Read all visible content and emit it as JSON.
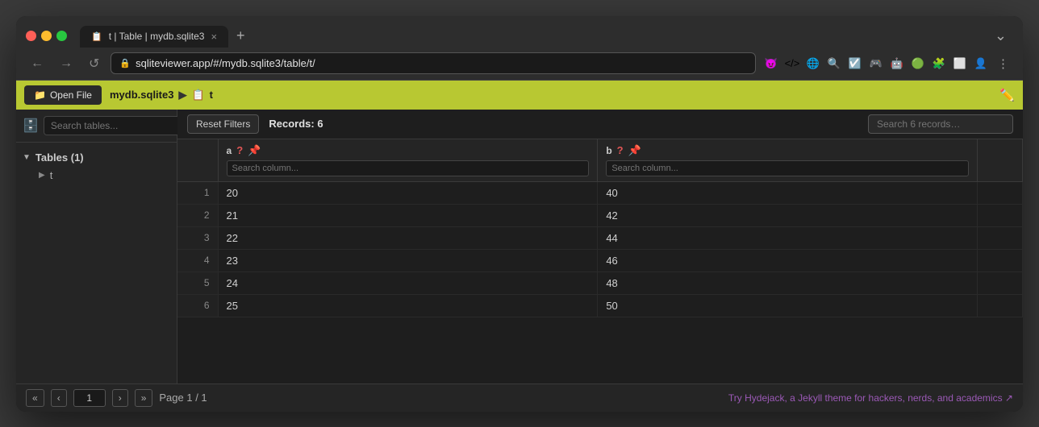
{
  "browser": {
    "tab_label": "t | Table | mydb.sqlite3",
    "tab_close": "×",
    "tab_new": "+",
    "tab_more": "⌄",
    "address": "sqliteviewer.app/#/mydb.sqlite3/table/t/",
    "back_btn": "←",
    "forward_btn": "→",
    "reload_btn": "↺"
  },
  "toolbar": {
    "open_file_label": "Open File",
    "breadcrumb_db": "mydb.sqlite3",
    "breadcrumb_table": "t",
    "breadcrumb_arrow": "▶"
  },
  "sidebar": {
    "search_placeholder": "Search tables...",
    "tables_header": "Tables (1)",
    "table_item": "t"
  },
  "content": {
    "reset_filters_label": "Reset Filters",
    "records_count": "Records: 6",
    "search_records_placeholder": "Search 6 records…",
    "columns": [
      {
        "name": "a",
        "search_placeholder": "Search column..."
      },
      {
        "name": "b",
        "search_placeholder": "Search column..."
      }
    ],
    "rows": [
      {
        "num": "1",
        "a": "20",
        "b": "40"
      },
      {
        "num": "2",
        "a": "21",
        "b": "42"
      },
      {
        "num": "3",
        "a": "22",
        "b": "44"
      },
      {
        "num": "4",
        "a": "23",
        "b": "46"
      },
      {
        "num": "5",
        "a": "24",
        "b": "48"
      },
      {
        "num": "6",
        "a": "25",
        "b": "50"
      }
    ]
  },
  "footer": {
    "first_page": "«",
    "prev_page": "‹",
    "next_page": "›",
    "last_page": "»",
    "page_value": "1",
    "page_info": "Page 1 / 1",
    "promo_text": "Try Hydejack, a Jekyll theme for hackers, nerds, and academics ↗"
  }
}
